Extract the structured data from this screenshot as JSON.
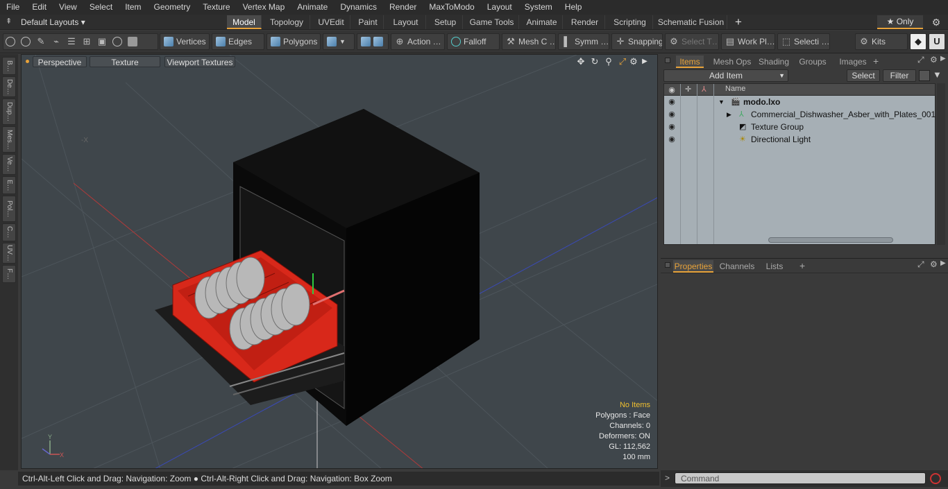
{
  "menubar": [
    "File",
    "Edit",
    "View",
    "Select",
    "Item",
    "Geometry",
    "Texture",
    "Vertex Map",
    "Animate",
    "Dynamics",
    "Render",
    "MaxToModo",
    "Layout",
    "System",
    "Help"
  ],
  "layout": {
    "selector": "Default Layouts ▾",
    "tabs": [
      "Model",
      "Topology",
      "UVEdit",
      "Paint",
      "Layout",
      "Setup",
      "Game Tools",
      "Animate",
      "Render",
      "Scripting",
      "Schematic Fusion"
    ],
    "active_tab": "Model",
    "only_label": "★  Only"
  },
  "toolbar": {
    "vertices": "Vertices",
    "edges": "Edges",
    "polygons": "Polygons",
    "action": "Action  …",
    "falloff": "Falloff",
    "mesh": "Mesh C …",
    "symm": "Symm …",
    "snapping": "Snapping",
    "select_t": "Select T…",
    "work_pl": "Work Pl…",
    "selecti": "Selecti …",
    "kits": "Kits"
  },
  "left_tabs": [
    "B…",
    "De…",
    "Dup…",
    "Mes…",
    "Ve…",
    "E…",
    "Pol…",
    "C…",
    "UV…",
    "F…"
  ],
  "viewport": {
    "perspective": "Perspective",
    "texture": "Texture",
    "viewport_textures": "Viewport Textures",
    "axis_neg_x": "-X",
    "info": {
      "no_items": "No Items",
      "polygons": "Polygons : Face",
      "channels": "Channels: 0",
      "deformers": "Deformers: ON",
      "gl": "GL: 112,562",
      "scale": "100 mm"
    }
  },
  "statusbar": "Ctrl-Alt-Left Click and Drag: Navigation: Zoom ● Ctrl-Alt-Right Click and Drag: Navigation: Box Zoom",
  "items_panel": {
    "tabs": [
      "Items",
      "Mesh Ops",
      "Shading",
      "Groups",
      "Images"
    ],
    "add_item": "Add Item",
    "select": "Select",
    "filter": "Filter",
    "name_header": "Name",
    "rows": [
      {
        "label": "modo.lxo"
      },
      {
        "label": "Commercial_Dishwasher_Asber_with_Plates_001"
      },
      {
        "label": "Texture Group"
      },
      {
        "label": "Directional Light"
      }
    ]
  },
  "props_panel": {
    "tabs": [
      "Properties",
      "Channels",
      "Lists"
    ]
  },
  "command": {
    "placeholder": "Command"
  }
}
